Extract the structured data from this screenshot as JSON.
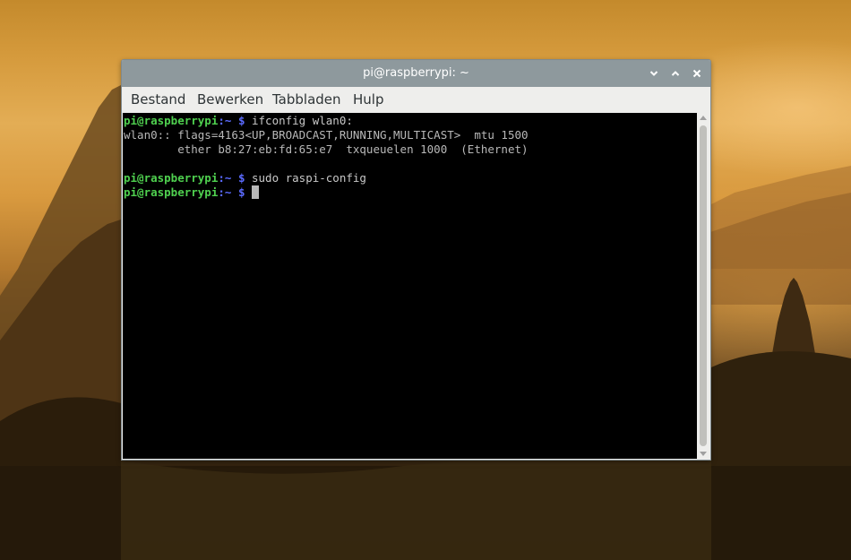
{
  "window": {
    "title": "pi@raspberrypi: ~"
  },
  "menu": {
    "items": [
      "Bestand",
      "Bewerken",
      "Tabbladen",
      "Hulp"
    ]
  },
  "terminal": {
    "prompt_user": "pi@raspberrypi",
    "prompt_path": ":~",
    "prompt_symbol": " $ ",
    "lines": [
      {
        "type": "prompt",
        "command": "ifconfig wlan0:"
      },
      {
        "type": "output",
        "text": "wlan0:: flags=4163<UP,BROADCAST,RUNNING,MULTICAST>  mtu 1500"
      },
      {
        "type": "output",
        "text": "        ether b8:27:eb:fd:65:e7  txqueuelen 1000  (Ethernet)"
      },
      {
        "type": "output",
        "text": ""
      },
      {
        "type": "prompt",
        "command": "sudo raspi-config"
      },
      {
        "type": "prompt",
        "command": "",
        "cursor": true
      }
    ]
  },
  "colors": {
    "prompt_user": "#4fd04f",
    "prompt_path": "#5b6bff",
    "titlebar": "#8e999d",
    "terminal_bg": "#000000"
  },
  "icons": [
    "minimize-icon",
    "maximize-icon",
    "close-icon"
  ]
}
